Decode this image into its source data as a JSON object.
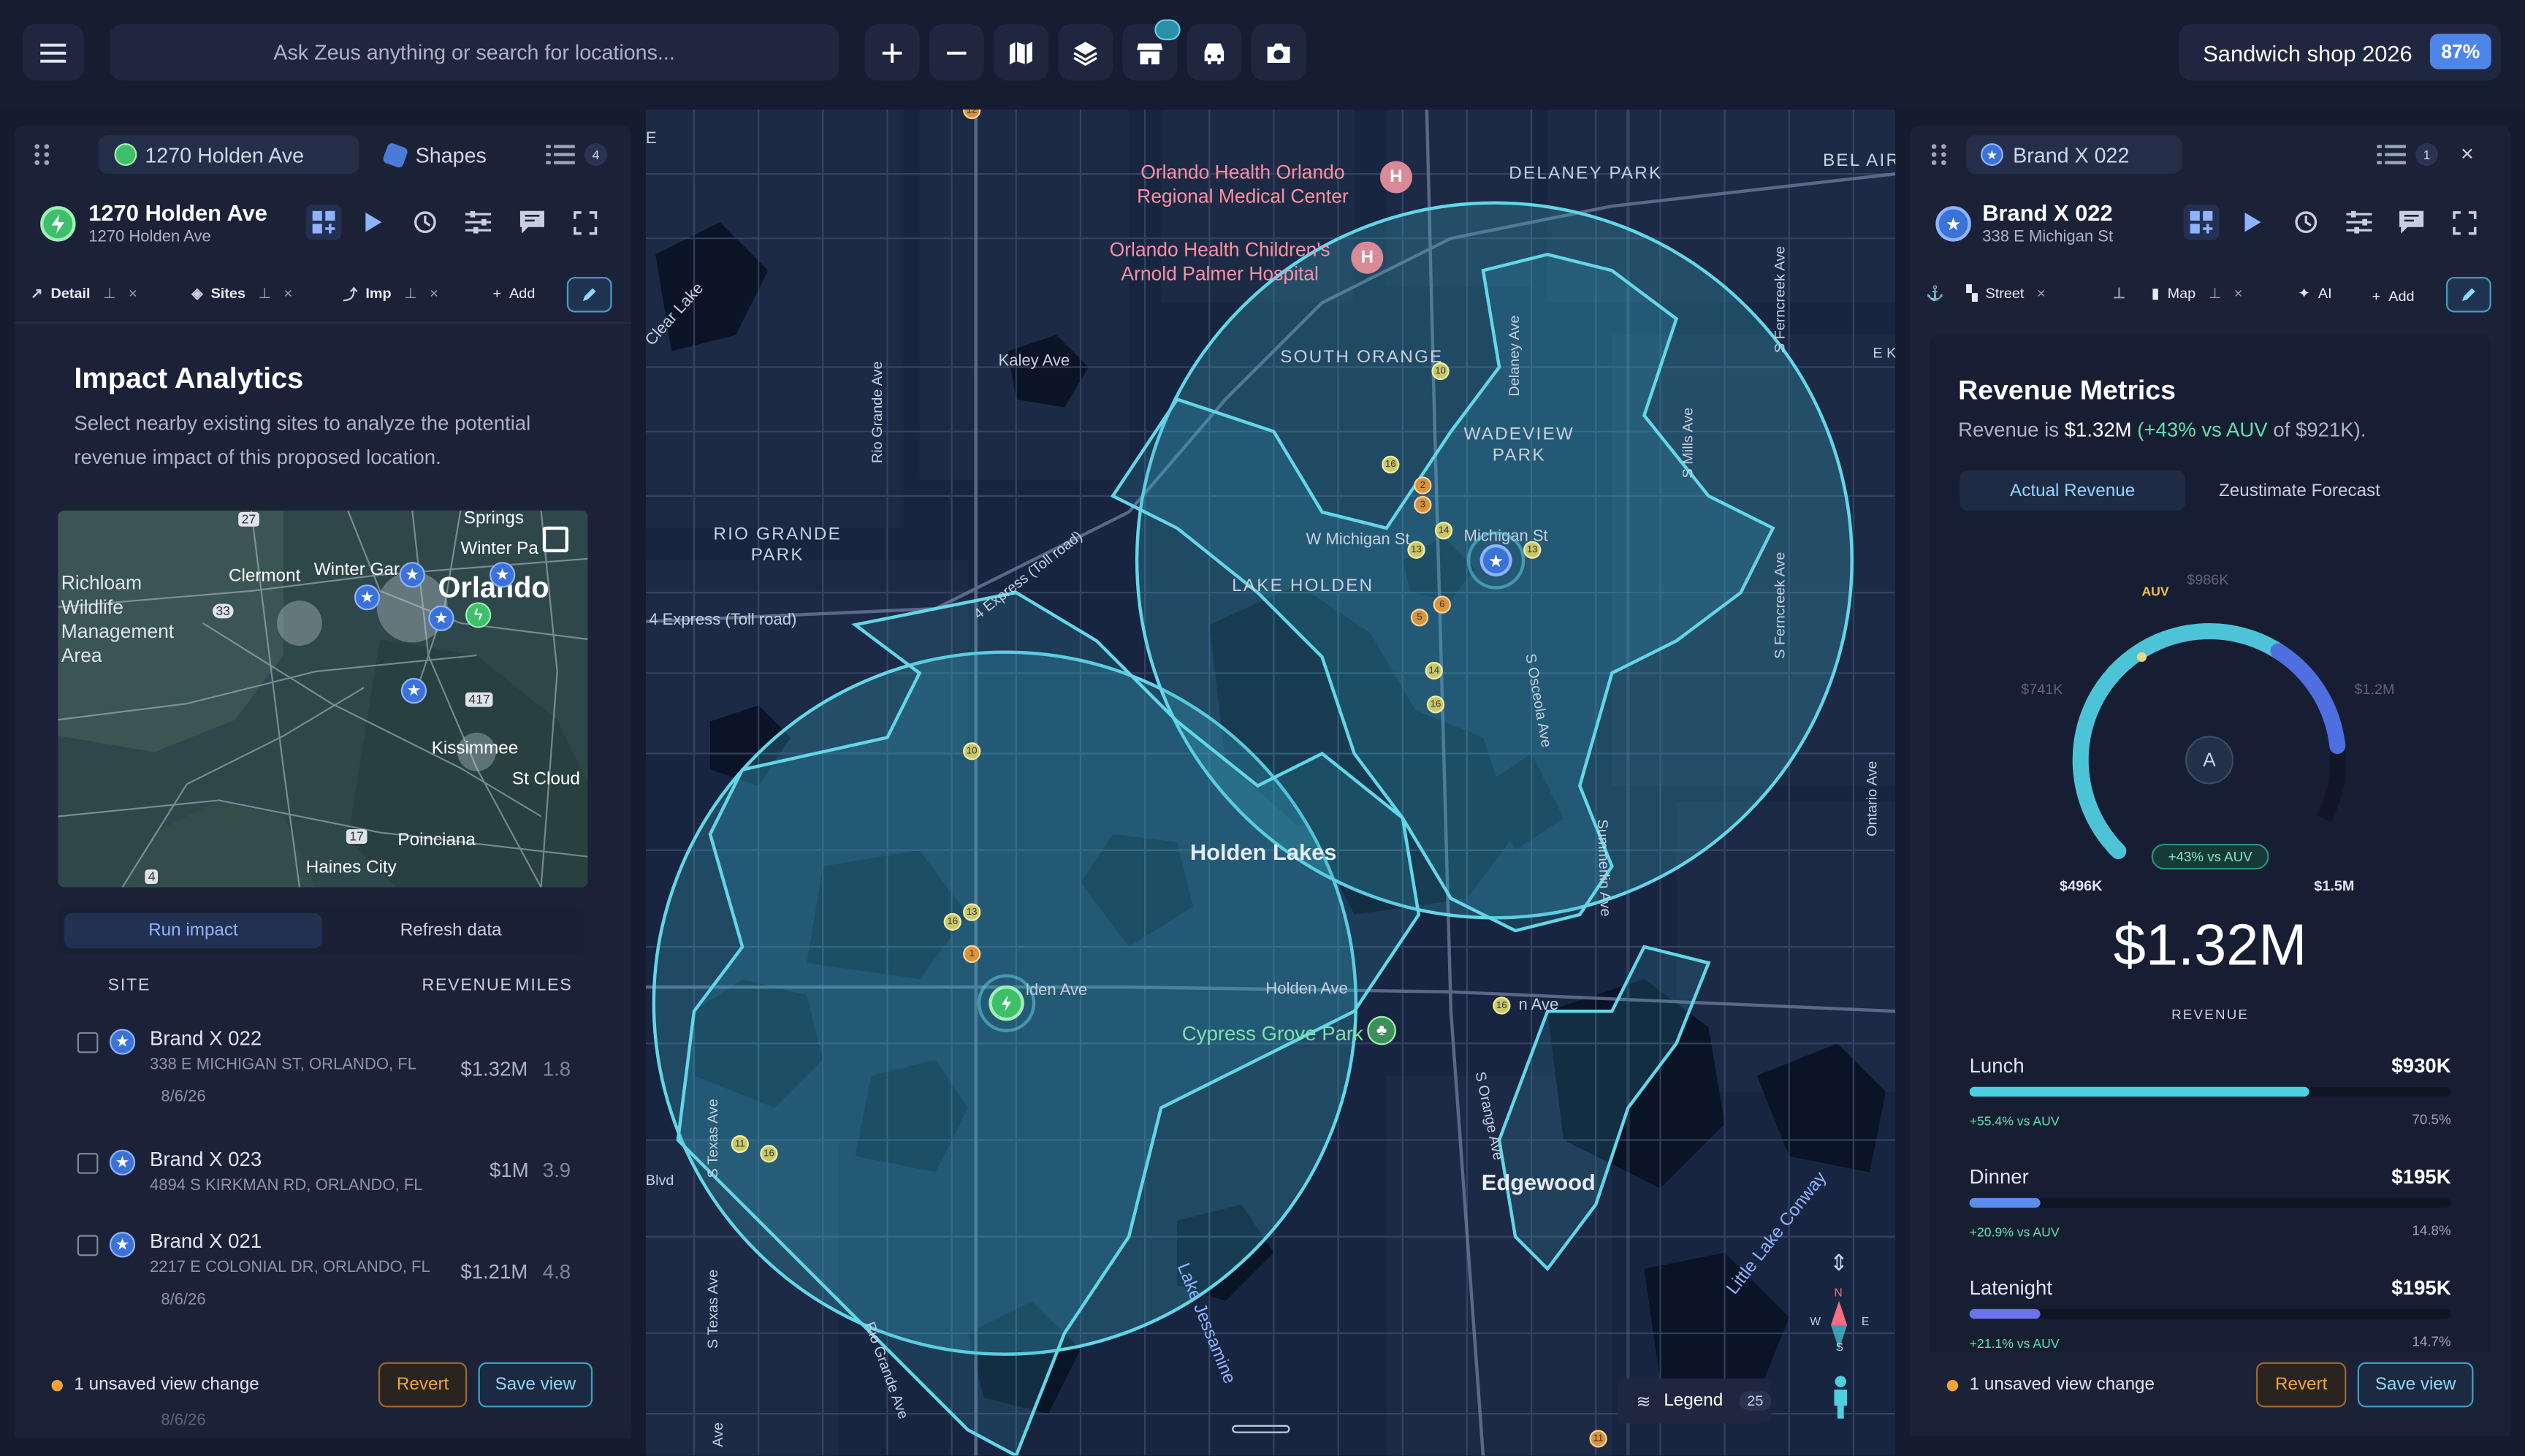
{
  "topbar": {
    "search_placeholder": "Ask Zeus anything or search for locations...",
    "tools": [
      "menu-icon",
      "zoom-in-icon",
      "zoom-out-icon",
      "map-icon",
      "layers-icon",
      "store-icon",
      "car-icon",
      "camera-icon"
    ],
    "project_name": "Sandwich shop 2026",
    "project_percent": "87%"
  },
  "left_panel": {
    "tab_active": "1270 Holden Ave",
    "tab_shapes": "Shapes",
    "list_count": "4",
    "site_title": "1270 Holden Ave",
    "site_subtitle": "1270 Holden Ave",
    "chips": [
      {
        "label": "Detail"
      },
      {
        "label": "Sites"
      },
      {
        "label": "Imp"
      },
      {
        "label": "Add"
      }
    ],
    "heading": "Impact Analytics",
    "description": "Select nearby existing sites to analyze the potential revenue impact of this proposed location.",
    "minimap_labels": {
      "springs": "Springs",
      "winter_park": "Winter Pa",
      "richloam": "Richloam\nWildlife\nManagement\nArea",
      "clermont": "Clermont",
      "winter_garden": "Winter Gar",
      "orlando": "Orlando",
      "kissimmee": "Kissimmee",
      "st_cloud": "St Cloud",
      "poinciana": "Poinciana",
      "haines_city": "Haines City",
      "hwy27": "27",
      "hwy33": "33",
      "hwy417": "417",
      "hwy17": "17",
      "hwy4": "4"
    },
    "actions": {
      "run": "Run impact",
      "refresh": "Refresh data"
    },
    "table": {
      "headers": {
        "site": "SITE",
        "revenue": "REVENUE",
        "miles": "MILES"
      },
      "rows": [
        {
          "name": "Brand X 022",
          "address": "338 E MICHIGAN ST, ORLANDO, FL",
          "date": "8/6/26",
          "revenue": "$1.32M",
          "miles": "1.8"
        },
        {
          "name": "Brand X 023",
          "address": "4894 S KIRKMAN RD, ORLANDO, FL",
          "date": "",
          "revenue": "$1M",
          "miles": "3.9"
        },
        {
          "name": "Brand X 021",
          "address": "2217 E COLONIAL DR, ORLANDO, FL",
          "date": "8/6/26",
          "revenue": "$1.21M",
          "miles": "4.8"
        }
      ],
      "faded_date": "8/6/26"
    },
    "footer": {
      "unsaved": "1 unsaved view change",
      "revert": "Revert",
      "save": "Save view"
    }
  },
  "map": {
    "labels": {
      "hospital1": "Orlando Health Orlando\nRegional Medical Center",
      "hospital2": "Orlando Health Children's\nArnold Palmer Hospital",
      "delaney_park": "DELANEY PARK",
      "bel_air": "BEL AIR",
      "south_orange": "SOUTH ORANGE",
      "wadeview": "WADEVIEW\nPARK",
      "rio_grande_park": "RIO GRANDE\nPARK",
      "lake_holden": "LAKE HOLDEN",
      "holden_lakes": "Holden Lakes",
      "edgewood": "Edgewood",
      "cypress_grove": "Cypress Grove Park",
      "kaley": "Kaley Ave",
      "w_michigan": "W Michigan St",
      "michigan_st": "Michigan St",
      "holden_ave": "Holden Ave",
      "holden_ave_pin": "lden Ave",
      "oak_ridge": "n Ave",
      "express": "4 Express (Toll road)",
      "express2": "4 Express (Toll road)",
      "clear_lake": "Clear Lake",
      "rio_grande_ave": "Rio Grande Ave",
      "rio_grande_ave2": "Rio Grande Ave",
      "delaney_ave": "Delaney Ave",
      "mills_ave": "S Mills Ave",
      "ferncreek": "S Ferncreek Ave",
      "ferncreek2": "S Ferncreek Ave",
      "osceola": "S Osceola Ave",
      "summerlin": "Summerlin Ave",
      "ontario": "Ontario Ave",
      "s_orange": "S Orange Ave",
      "texas1": "S Texas Ave",
      "texas2": "S Texas Ave",
      "jessamine": "Lake Jessamine",
      "conway": "Little Lake Conway",
      "blvd": "Blvd",
      "ave_bottom": "Ave",
      "e_edge": "E",
      "ka_edge": "E Ka"
    },
    "legend": {
      "label": "Legend",
      "count": "25"
    },
    "compass": {
      "n": "N",
      "w": "W",
      "e": "E",
      "s": "S"
    }
  },
  "right_panel": {
    "tab_active": "Brand X 022",
    "list_count": "1",
    "site_title": "Brand X 022",
    "site_subtitle": "338 E Michigan St",
    "chips": [
      {
        "label": "Street"
      },
      {
        "label": "Map"
      },
      {
        "label": "AI"
      },
      {
        "label": "Add"
      }
    ],
    "heading": "Revenue Metrics",
    "summary_prefix": "Revenue is ",
    "summary_value": "$1.32M",
    "summary_delta": "(+43% vs AUV",
    "summary_suffix": " of $921K).",
    "tabs": {
      "actual": "Actual Revenue",
      "forecast": "Zeustimate Forecast"
    },
    "gauge": {
      "auv": "AUV",
      "p986": "$986K",
      "p741": "$741K",
      "p12": "$1.2M",
      "min": "$496K",
      "max": "$1.5M",
      "badge_letter": "A",
      "delta_badge": "+43% vs AUV",
      "fraction": 0.81
    },
    "big_value": "$1.32M",
    "big_label": "REVENUE",
    "metrics": [
      {
        "name": "Lunch",
        "value": "$930K",
        "delta": "+55.4% vs AUV",
        "share": "70.5%",
        "fill": 0.705,
        "color": "#4dd0e1"
      },
      {
        "name": "Dinner",
        "value": "$195K",
        "delta": "+20.9% vs AUV",
        "share": "14.8%",
        "fill": 0.148,
        "color": "#5b8def"
      },
      {
        "name": "Latenight",
        "value": "$195K",
        "delta": "+21.1% vs AUV",
        "share": "14.7%",
        "fill": 0.147,
        "color": "#6a74e8"
      }
    ],
    "footer": {
      "unsaved": "1 unsaved view change",
      "revert": "Revert",
      "save": "Save view"
    }
  }
}
